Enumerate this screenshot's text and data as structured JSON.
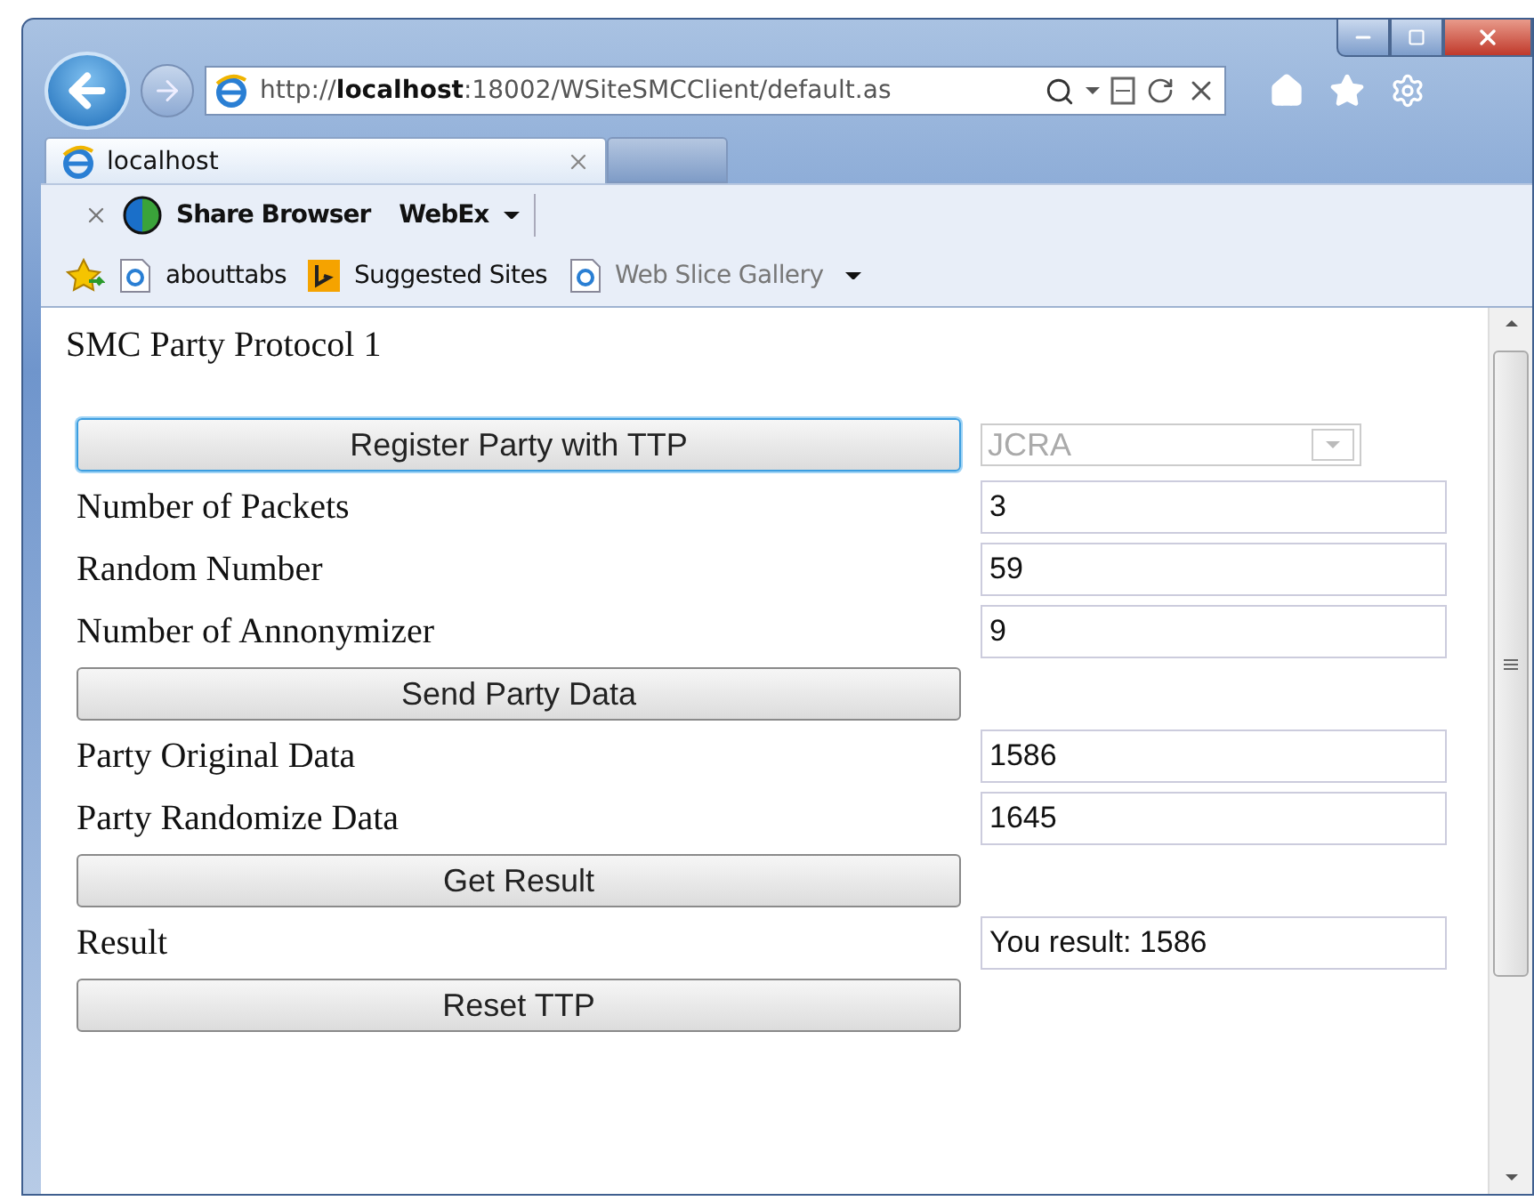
{
  "window": {
    "address": "http://**localhost**:18002/WSiteSMCClient/default.as",
    "tabs": [
      {
        "label": "localhost",
        "selected": true
      }
    ]
  },
  "command_bar": {
    "items": [
      "Share Browser",
      "WebEx"
    ]
  },
  "favorites_bar": {
    "items": [
      {
        "label": "abouttabs",
        "kind": "page",
        "disabled": false
      },
      {
        "label": "Suggested Sites",
        "kind": "bing",
        "disabled": false
      },
      {
        "label": "Web Slice Gallery",
        "kind": "page",
        "disabled": true
      }
    ]
  },
  "page": {
    "heading": "SMC Party  Protocol 1",
    "rows": [
      {
        "kind": "button",
        "label": "Register Party with TTP",
        "focused": true,
        "select": {
          "value": "JCRA",
          "disabled": true
        }
      },
      {
        "kind": "field",
        "label": "Number of Packets",
        "value": "3"
      },
      {
        "kind": "field",
        "label": "Random Number",
        "value": "59"
      },
      {
        "kind": "field",
        "label": "Number of Annonymizer",
        "value": "9"
      },
      {
        "kind": "button",
        "label": "Send Party Data",
        "focused": false
      },
      {
        "kind": "field",
        "label": "Party Original Data",
        "value": "1586"
      },
      {
        "kind": "field",
        "label": "Party Randomize Data",
        "value": "1645"
      },
      {
        "kind": "button",
        "label": "Get Result",
        "focused": false
      },
      {
        "kind": "field",
        "label": "Result",
        "value": "You result: 1586"
      },
      {
        "kind": "button",
        "label": "Reset TTP",
        "focused": false
      }
    ]
  }
}
